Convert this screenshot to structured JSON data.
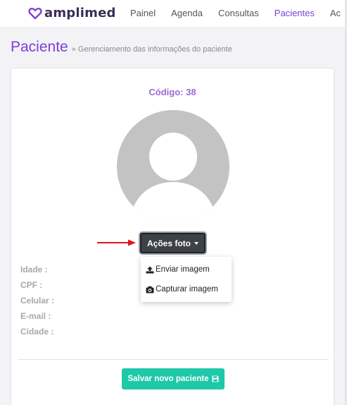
{
  "brand": {
    "name": "amplimed",
    "color": "#7b3fd6"
  },
  "nav": {
    "items": [
      {
        "label": "Painel"
      },
      {
        "label": "Agenda"
      },
      {
        "label": "Consultas"
      },
      {
        "label": "Pacientes"
      },
      {
        "label": "Ac"
      }
    ],
    "active": "Pacientes"
  },
  "page": {
    "title": "Paciente",
    "subtitle": "» Gerenciamento das informações do paciente"
  },
  "patient": {
    "code_label": "Código: 38"
  },
  "photo_actions": {
    "button_label": "Ações foto",
    "menu": [
      {
        "label": "Enviar imagem",
        "icon": "upload-icon"
      },
      {
        "label": "Capturar imagem",
        "icon": "camera-icon"
      }
    ]
  },
  "fields": [
    {
      "label": "Idade :"
    },
    {
      "label": "CPF :"
    },
    {
      "label": "Celular :"
    },
    {
      "label": "E-mail :"
    },
    {
      "label": "Cidade :"
    }
  ],
  "actions": {
    "save_label": "Salvar novo paciente",
    "save_icon": "floppy-disk-icon",
    "save_color": "#1ec8a8"
  }
}
